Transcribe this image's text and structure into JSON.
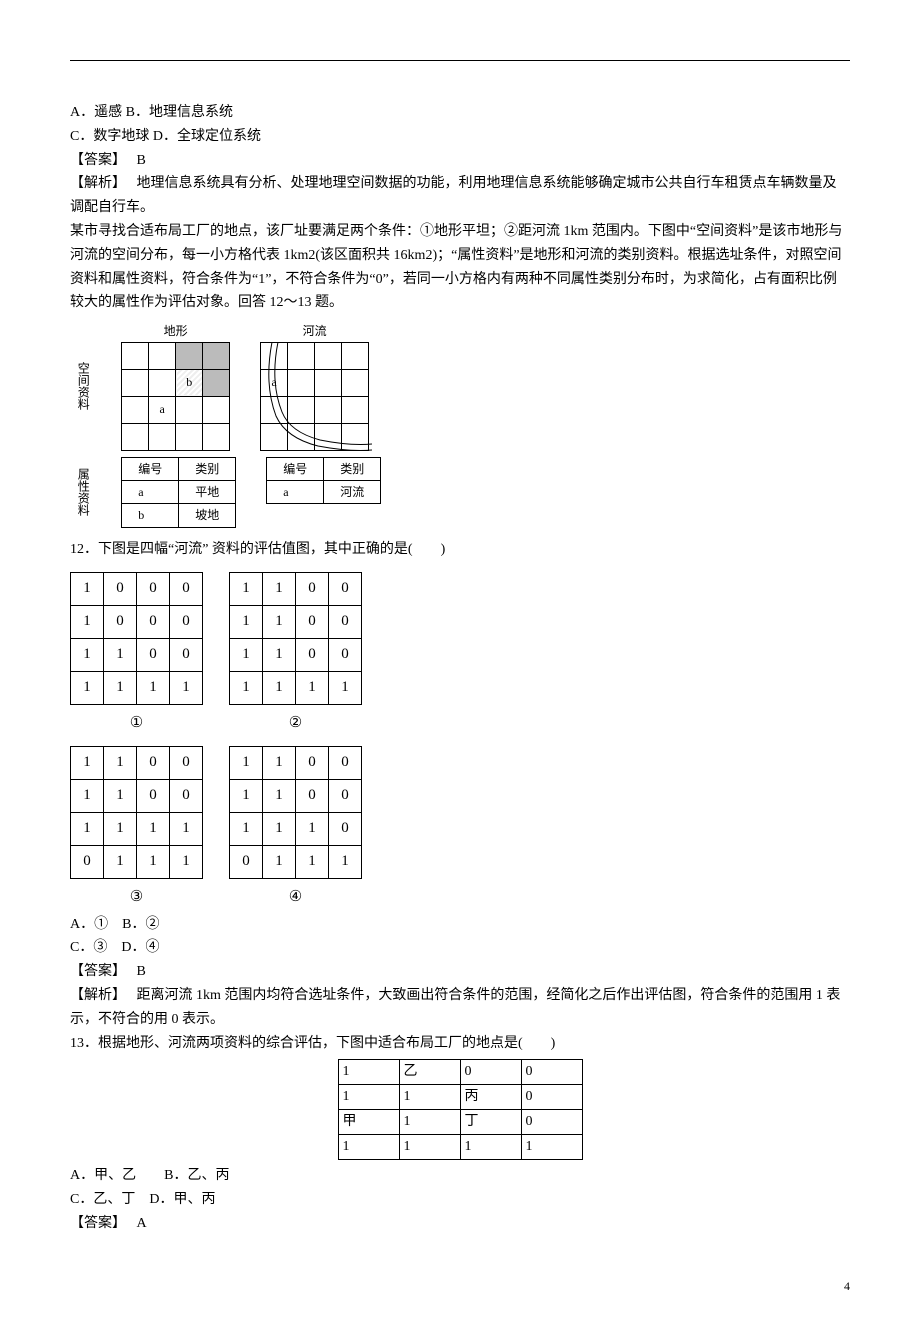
{
  "q11": {
    "options": [
      "A．遥感",
      "B．地理信息系统",
      "C．数字地球",
      "D．全球定位系统"
    ],
    "answer_label": "【答案】",
    "answer_value": "B",
    "explain_label": "【解析】",
    "explain_text": "地理信息系统具有分析、处理地理空间数据的功能，利用地理信息系统能够确定城市公共自行车租赁点车辆数量及调配自行车。"
  },
  "passage": {
    "text": "某市寻找合适布局工厂的地点，该厂址要满足两个条件：①地形平坦；②距河流 1km 范围内。下图中“空间资料”是该市地形与河流的空间分布，每一小方格代表 1km2(该区面积共 16km2)；“属性资料”是地形和河流的类别资料。根据选址条件，对照空间资料和属性资料，符合条件为“1”，不符合条件为“0”，若同一小方格内有两种不同属性类别分布时，为求简化，占有面积比例较大的属性作为评估对象。回答 12～13 题。"
  },
  "spatial": {
    "vlabel_sp": "空间资料",
    "vlabel_attr": "属性资料",
    "cap_terrain": "地形",
    "cap_river": "河流",
    "terrain_letters": {
      "b": "b",
      "a": "a"
    },
    "river_letter": "a",
    "attr_headers": [
      "编号",
      "类别"
    ],
    "attr_terrain": [
      [
        "a",
        "平地"
      ],
      [
        "b",
        "坡地"
      ]
    ],
    "attr_river": [
      [
        "a",
        "河流"
      ]
    ]
  },
  "q12": {
    "text": "12．下图是四幅“河流” 资料的评估值图，其中正确的是(　　)",
    "options": [
      "A．①　B．②",
      "C．③　D．④"
    ],
    "answer_label": "【答案】",
    "answer_value": "B",
    "explain_label": "【解析】",
    "explain_text": "距离河流 1km 范围内均符合选址条件，大致画出符合条件的范围，经简化之后作出评估图，符合条件的范围用 1 表示，不符合的用 0 表示。",
    "labels": [
      "①",
      "②",
      "③",
      "④"
    ],
    "g1": [
      [
        1,
        0,
        0,
        0
      ],
      [
        1,
        0,
        0,
        0
      ],
      [
        1,
        1,
        0,
        0
      ],
      [
        1,
        1,
        1,
        1
      ]
    ],
    "g2": [
      [
        1,
        1,
        0,
        0
      ],
      [
        1,
        1,
        0,
        0
      ],
      [
        1,
        1,
        0,
        0
      ],
      [
        1,
        1,
        1,
        1
      ]
    ],
    "g3": [
      [
        1,
        1,
        0,
        0
      ],
      [
        1,
        1,
        0,
        0
      ],
      [
        1,
        1,
        1,
        1
      ],
      [
        0,
        1,
        1,
        1
      ]
    ],
    "g4": [
      [
        1,
        1,
        0,
        0
      ],
      [
        1,
        1,
        0,
        0
      ],
      [
        1,
        1,
        1,
        0
      ],
      [
        0,
        1,
        1,
        1
      ]
    ]
  },
  "q13": {
    "text": "13．根据地形、河流两项资料的综合评估，下图中适合布局工厂的地点是(　　)",
    "grid": [
      [
        "1",
        "乙",
        "0",
        "0"
      ],
      [
        "1",
        "1",
        "丙",
        "0"
      ],
      [
        "甲",
        "1",
        "丁",
        "0"
      ],
      [
        "1",
        "1",
        "1",
        "1"
      ]
    ],
    "options": [
      " A．甲、乙　　B．乙、丙",
      "C．乙、丁　D．甲、丙"
    ],
    "answer_label": "【答案】",
    "answer_value": "A"
  },
  "page_number": "4"
}
